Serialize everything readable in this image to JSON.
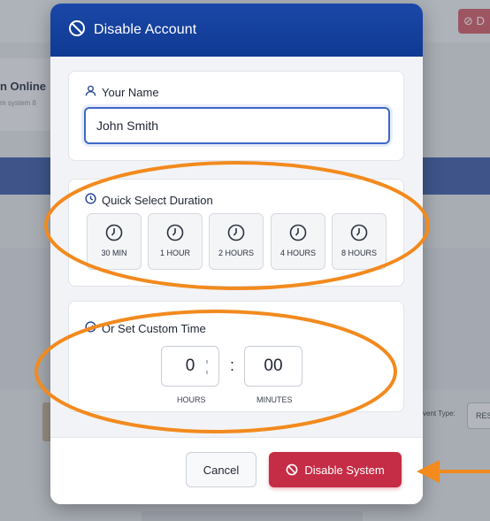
{
  "background": {
    "top_button_label": "⊘ D",
    "card_title": "n Online",
    "card_subtitle": "m system 8",
    "event_type_label": "vent Type:",
    "event_type_value": "RES"
  },
  "modal": {
    "title": "Disable Account",
    "name_section": {
      "label": "Your Name",
      "input_value": "John Smith"
    },
    "quick_section": {
      "label": "Quick Select Duration",
      "options": [
        "30 MIN",
        "1 HOUR",
        "2 HOURS",
        "4 HOURS",
        "8 HOURS"
      ]
    },
    "custom_section": {
      "label": "Or Set Custom Time",
      "hours_value": "0",
      "separator": ":",
      "minutes_value": "00",
      "hours_caption": "HOURS",
      "minutes_caption": "MINUTES"
    },
    "footer": {
      "cancel_label": "Cancel",
      "disable_label": "Disable System"
    }
  },
  "colors": {
    "header_blue": "#1b47a8",
    "danger_red": "#c52c45",
    "annotation_orange": "#f28a1e",
    "focus_blue": "#3f68c6"
  },
  "icons": {
    "title": "ban-icon",
    "name": "user-icon",
    "quick": "clock-icon",
    "custom": "check-circle-icon",
    "disable": "ban-icon"
  }
}
